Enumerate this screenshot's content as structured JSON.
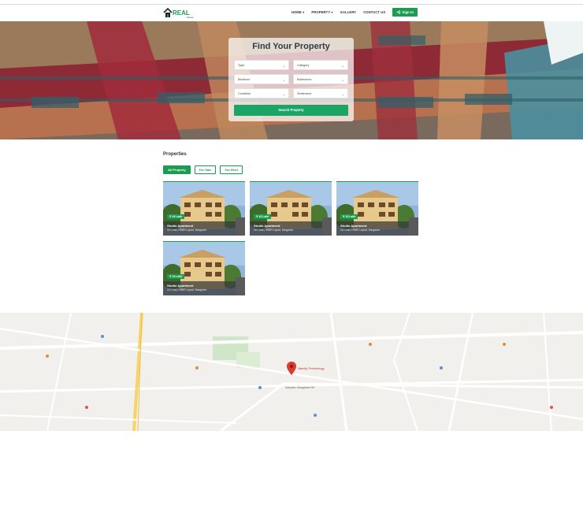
{
  "brand": {
    "logo_text": "REAL",
    "logo_sub": "Estate",
    "colors": {
      "primary": "#1b9c52",
      "search": "#1aa567"
    }
  },
  "nav": {
    "home": "HOME ▾",
    "property": "PROPERTY ▾",
    "gallery": "GALLERY",
    "contact": "CONTACT US",
    "signin": "Sign In",
    "signin_icon": "sign-in-icon"
  },
  "search": {
    "title": "Find Your Property",
    "selects": [
      {
        "label": "Type"
      },
      {
        "label": "Category"
      },
      {
        "label": "Bedroom"
      },
      {
        "label": "Bathrooms"
      },
      {
        "label": "Condition"
      },
      {
        "label": "Settlement"
      }
    ],
    "button": "Search Property"
  },
  "properties": {
    "title": "Properties",
    "filters": [
      "All Property",
      "For Sale",
      "For Rent"
    ],
    "cards": [
      {
        "price": "₹ 15 Lakh",
        "name": "Studio Apartment",
        "address": "15 Cross, HRBR Layout, Bangalore"
      },
      {
        "price": "₹ 15 Lakh",
        "name": "Studio Apartment",
        "address": "15 Cross, HRBR Layout, Bangalore"
      },
      {
        "price": "₹ 15 Lakh",
        "name": "Studio Apartment",
        "address": "15 Cross, HRBR Layout, Bangalore"
      },
      {
        "price": "₹ 15 Lakh",
        "name": "Studio Apartment",
        "address": "15 Cross, HRBR Layout, Bangalore"
      }
    ]
  },
  "map": {
    "pin_label": "Namity Technology",
    "road_label": "Satyadev Mangaldas Rd"
  }
}
